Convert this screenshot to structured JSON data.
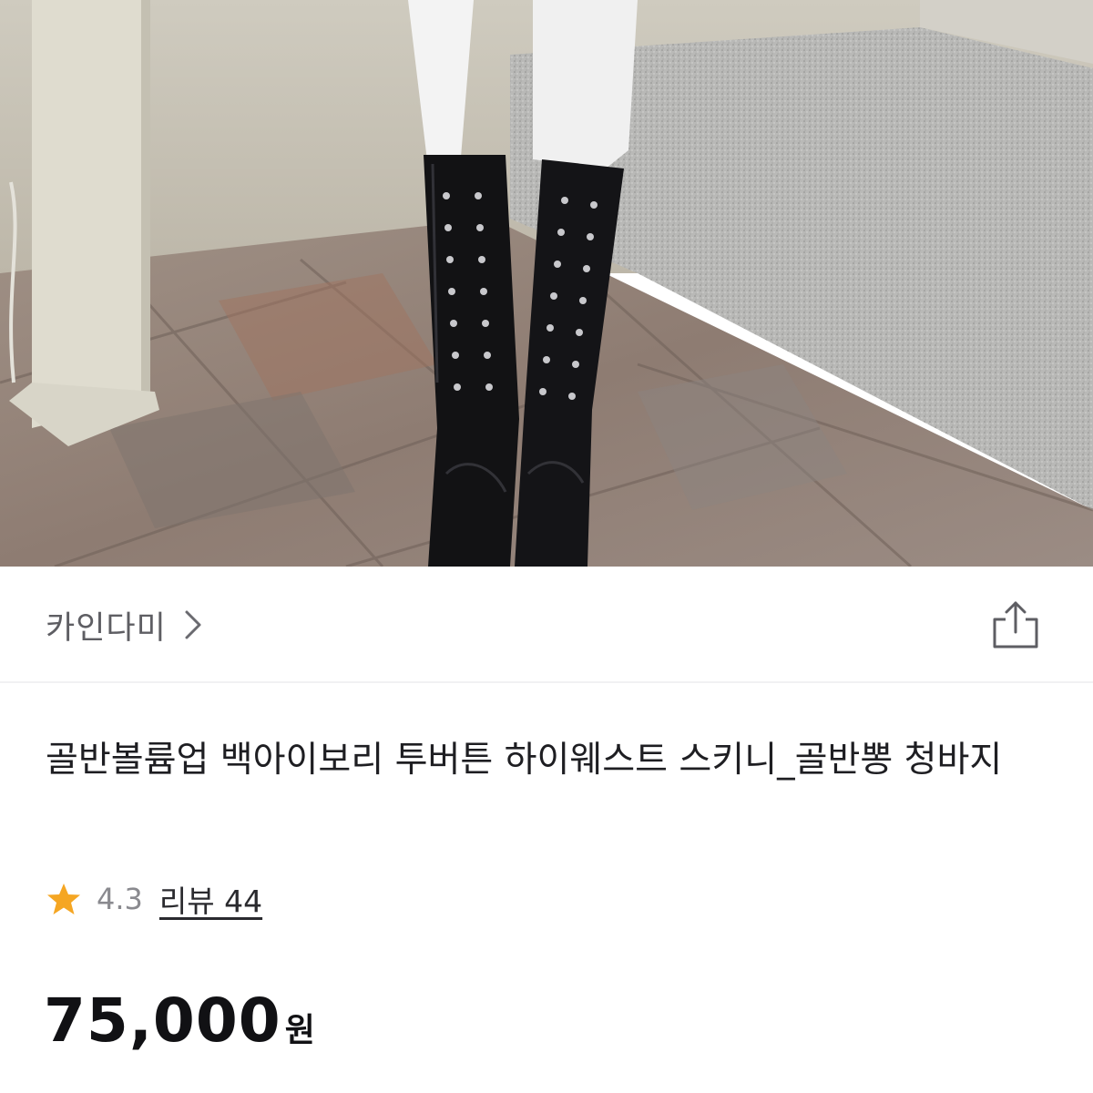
{
  "product_image": {
    "icon": "product-photo-knee-high-lace-up-boots"
  },
  "store": {
    "name": "카인다미",
    "chevron_icon": "chevron-right-icon"
  },
  "share": {
    "icon": "share-icon"
  },
  "product": {
    "title": "골반볼륨업 백아이보리 투버튼 하이웨스트 스키니_골반뽕 청바지",
    "rating": "4.3",
    "review_label": "리뷰 44",
    "price": "75,000",
    "currency": "원"
  },
  "colors": {
    "star": "#F5A623",
    "text_primary": "#1E1E22",
    "text_secondary": "#8A8A8F"
  }
}
